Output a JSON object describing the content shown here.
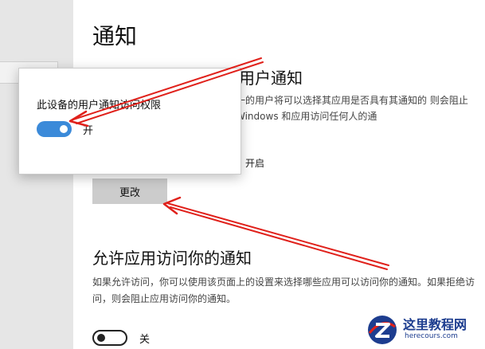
{
  "page": {
    "title": "通知"
  },
  "user_notifications": {
    "title": "用户通知",
    "description": "一的用户将可以选择其应用是否具有其通知的 则会阻止 Windows 和应用访问任何人的通",
    "status": "开启",
    "change_label": "更改"
  },
  "popup": {
    "label": "此设备的用户通知访问权限",
    "toggle_state_label": "开",
    "toggle_on": true
  },
  "app_access": {
    "title": "允许应用访问你的通知",
    "description": "如果允许访问，你可以使用该页面上的设置来选择哪些应用可以访问你的通知。如果拒绝访问，则会阻止应用访问你的通知。",
    "toggle_state_label": "关",
    "toggle_on": false
  },
  "annotation": {
    "arrow_color": "#e0211b"
  },
  "watermark": {
    "title": "这里教程网",
    "url": "herecours.com"
  },
  "colors": {
    "accent": "#3b8ad9",
    "button_bg": "#cccccc",
    "sidebar_bg": "#e6e6e6"
  }
}
